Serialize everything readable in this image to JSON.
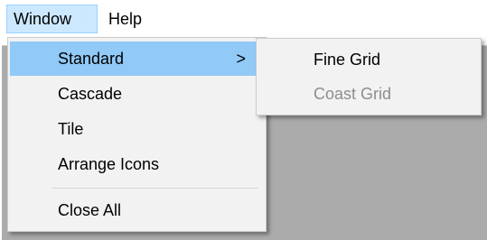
{
  "menubar": {
    "items": [
      {
        "label": "Window"
      },
      {
        "label": "Help"
      }
    ]
  },
  "window_menu": {
    "items": [
      {
        "label": "Standard",
        "submenu_arrow": ">"
      },
      {
        "label": "Cascade"
      },
      {
        "label": "Tile"
      },
      {
        "label": "Arrange Icons"
      },
      {
        "label": "Close All"
      }
    ]
  },
  "standard_submenu": {
    "items": [
      {
        "label": "Fine Grid",
        "enabled": true
      },
      {
        "label": "Coast Grid",
        "enabled": false
      }
    ]
  },
  "colors": {
    "menubar_active_bg": "#cce8ff",
    "menu_highlight_bg": "#91c9f7",
    "menu_bg": "#f2f2f2",
    "workspace_bg": "#ababab",
    "disabled_text": "#8d8d8d"
  }
}
